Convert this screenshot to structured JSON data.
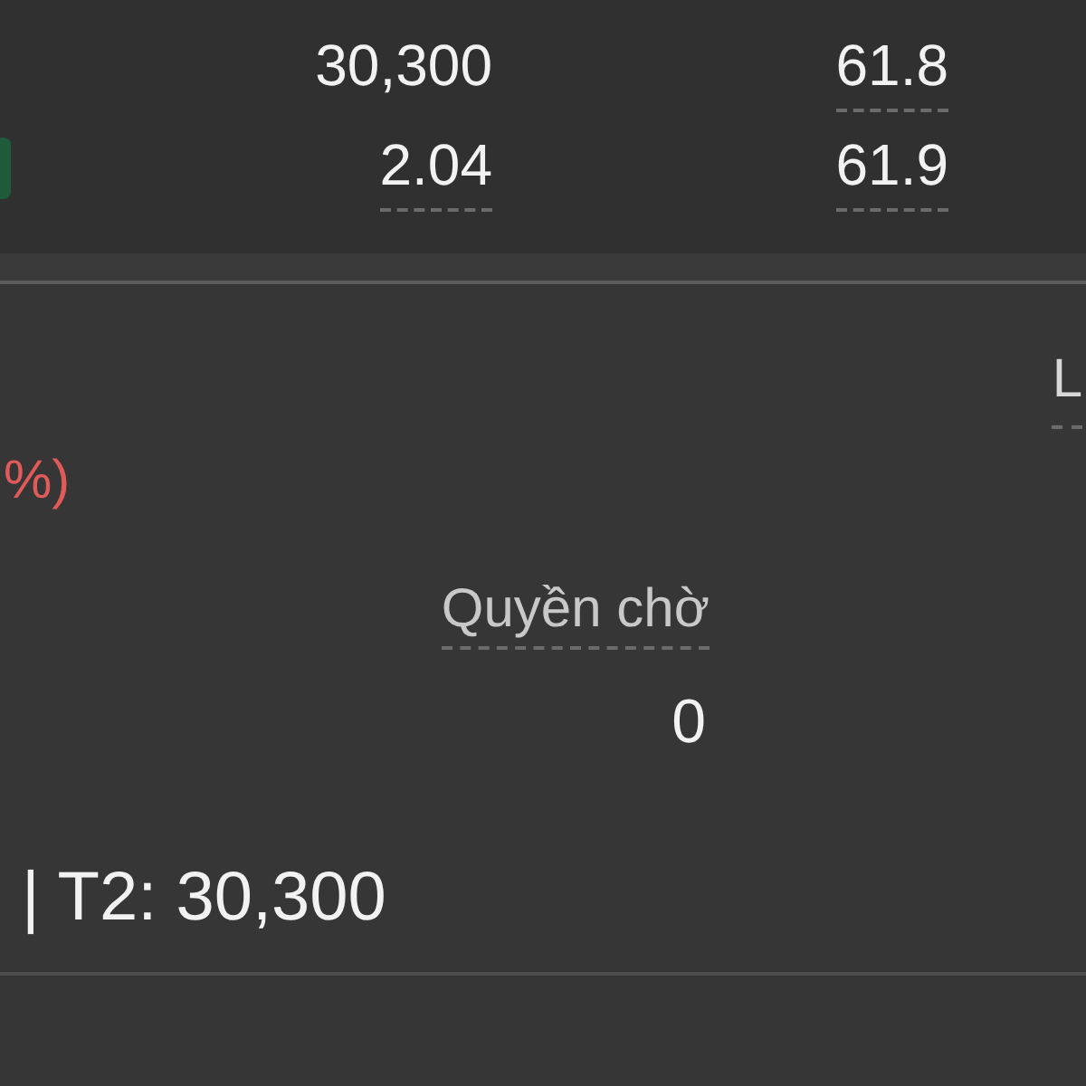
{
  "quote_rows": [
    {
      "cells": [
        {
          "text": "30,300",
          "underlined": false
        },
        {
          "text": "61.8",
          "underlined": true
        }
      ]
    },
    {
      "cells": [
        {
          "text": "2.04",
          "underlined": true
        },
        {
          "text": "61.9",
          "underlined": true
        }
      ]
    }
  ],
  "info": {
    "cut_label": "L",
    "change_tail": "%)",
    "pending_label": "Quyền chờ",
    "pending_value": "0",
    "t2_line": "| T2: 30,300"
  }
}
